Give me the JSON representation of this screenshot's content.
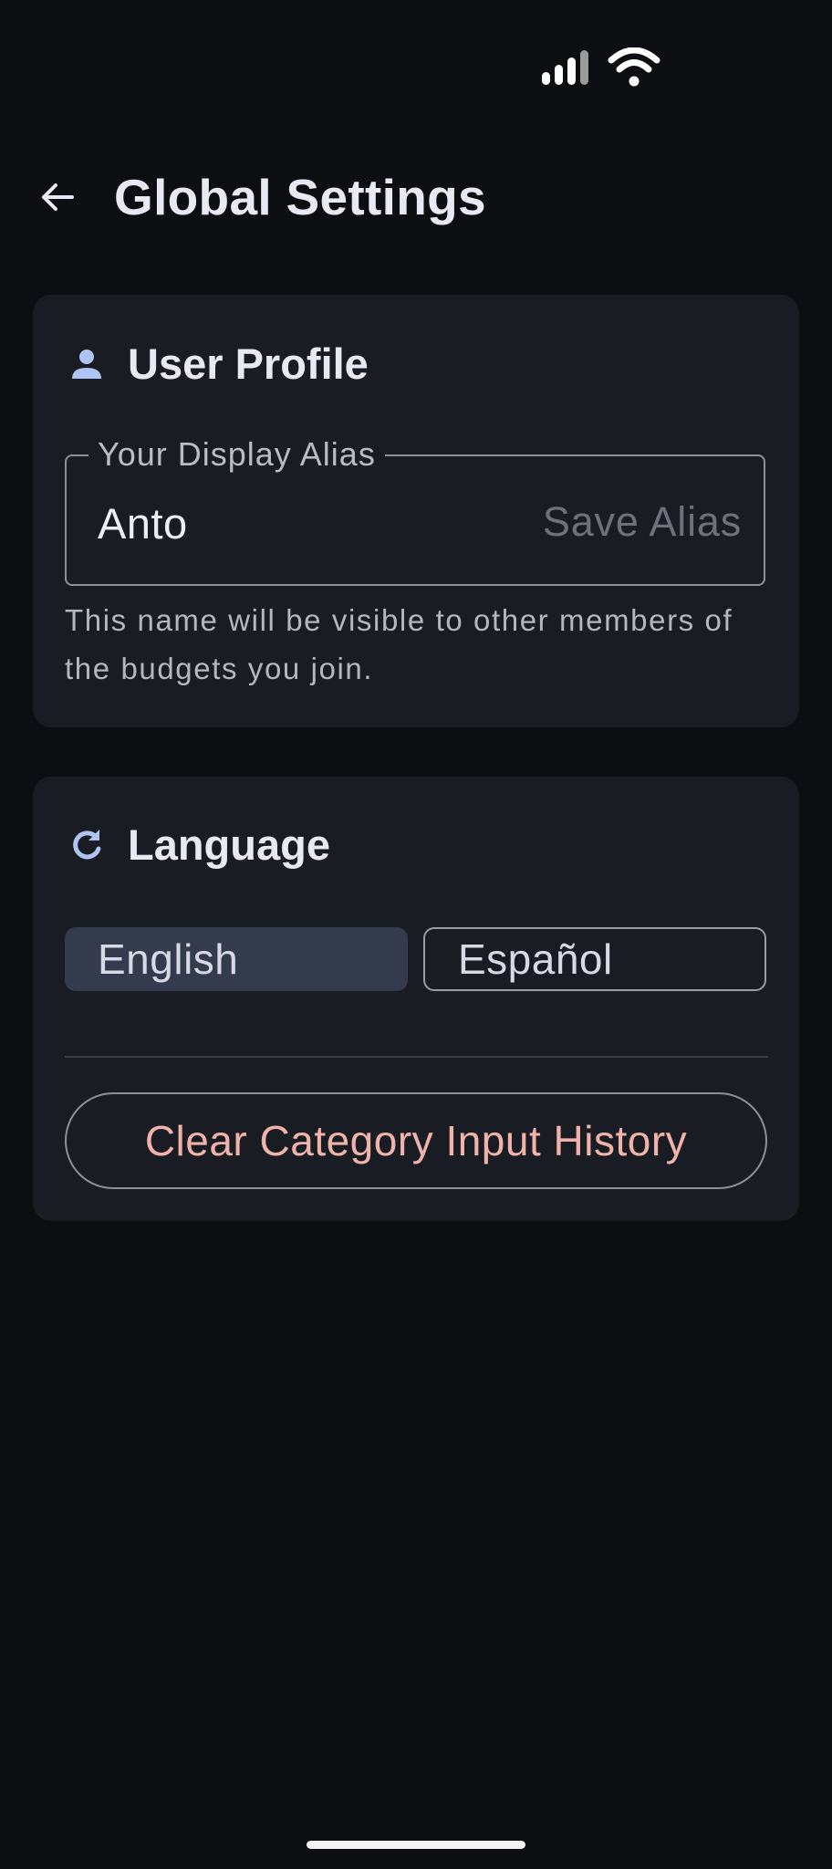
{
  "status_bar": {
    "signal_icon": "cellular-signal-icon",
    "wifi_icon": "wifi-icon"
  },
  "header": {
    "back_icon": "arrow-left-icon",
    "title": "Global Settings"
  },
  "profile_card": {
    "icon": "person-icon",
    "title": "User Profile",
    "alias_label": "Your Display Alias",
    "alias_value": "Anto",
    "save_label": "Save Alias",
    "helper_text": "This name will be visible to other members of the budgets you join."
  },
  "language_card": {
    "icon": "refresh-icon",
    "title": "Language",
    "options": [
      {
        "label": "English",
        "selected": true
      },
      {
        "label": "Español",
        "selected": false
      }
    ],
    "clear_history_label": "Clear Category Input History"
  },
  "colors": {
    "background": "#0d0e12",
    "card": "#1a1c23",
    "accent_icon": "#aec4f2",
    "selected_chip": "#343b4c",
    "destructive_text": "#f0b3aa"
  }
}
